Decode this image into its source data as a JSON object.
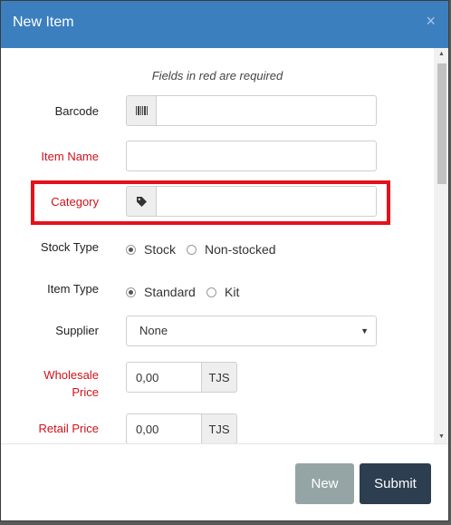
{
  "modal": {
    "title": "New Item",
    "close_label": "×"
  },
  "form": {
    "required_note": "Fields in red are required",
    "barcode": {
      "label": "Barcode",
      "value": ""
    },
    "item_name": {
      "label": "Item Name",
      "value": ""
    },
    "category": {
      "label": "Category",
      "value": ""
    },
    "stock_type": {
      "label": "Stock Type",
      "options": [
        "Stock",
        "Non-stocked"
      ],
      "selected": "Stock"
    },
    "item_type": {
      "label": "Item Type",
      "options": [
        "Standard",
        "Kit"
      ],
      "selected": "Standard"
    },
    "supplier": {
      "label": "Supplier",
      "value": "None"
    },
    "wholesale_price": {
      "label_line1": "Wholesale",
      "label_line2": "Price",
      "value": "0,00",
      "currency": "TJS"
    },
    "retail_price": {
      "label": "Retail Price",
      "value": "0,00",
      "currency": "TJS"
    }
  },
  "footer": {
    "new_label": "New",
    "submit_label": "Submit"
  },
  "colors": {
    "header": "#3c7fbf",
    "required": "#d0111a",
    "highlight": "#e3121b",
    "new_button": "#95a5a6",
    "submit_button": "#2c3e50"
  },
  "icons": {
    "barcode": "barcode-icon",
    "category": "tag-icon",
    "select": "caret-down-icon",
    "close": "close-icon"
  }
}
